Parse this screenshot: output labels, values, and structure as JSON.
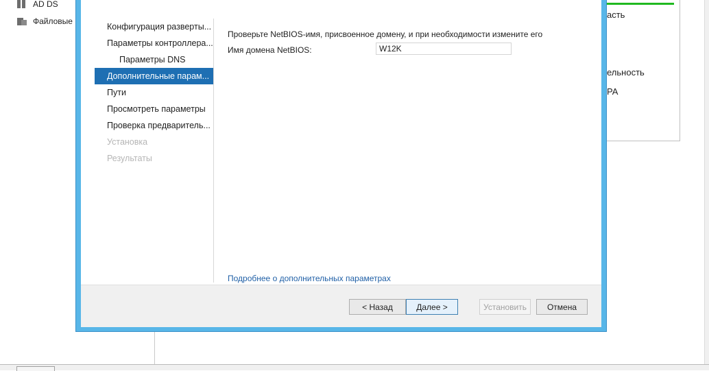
{
  "background": {
    "nav_items": [
      {
        "label": "AD DS",
        "icon": "server-icon"
      },
      {
        "label": "Файловые",
        "icon": "file-services-icon"
      }
    ],
    "tile_fragments": [
      "асть",
      "ельность",
      "РА"
    ],
    "accent_green": "#1fb91f"
  },
  "wizard": {
    "steps": [
      {
        "label": "Конфигурация разверты...",
        "state": "normal"
      },
      {
        "label": "Параметры контроллера...",
        "state": "normal"
      },
      {
        "label": "Параметры DNS",
        "state": "sub"
      },
      {
        "label": "Дополнительные парам...",
        "state": "active"
      },
      {
        "label": "Пути",
        "state": "normal"
      },
      {
        "label": "Просмотреть параметры",
        "state": "normal"
      },
      {
        "label": "Проверка предваритель...",
        "state": "normal"
      },
      {
        "label": "Установка",
        "state": "disabled"
      },
      {
        "label": "Результаты",
        "state": "disabled"
      }
    ],
    "instruction": "Проверьте NetBIOS-имя, присвоенное домену, и при необходимости измените его",
    "netbios_label": "Имя домена NetBIOS:",
    "netbios_value": "W12K",
    "more_link": "Подробнее о дополнительных параметрах",
    "buttons": {
      "back": "< Назад",
      "next": "Далее >",
      "install": "Установить",
      "cancel": "Отмена"
    },
    "frame_color": "#58b6e8",
    "active_step_color": "#1e6fb3"
  }
}
